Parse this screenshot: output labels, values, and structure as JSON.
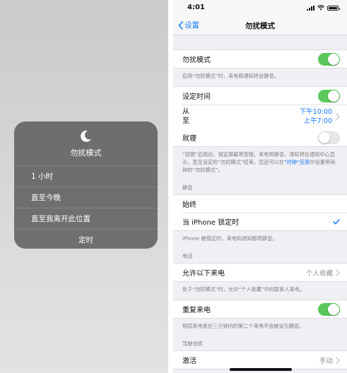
{
  "control_center": {
    "icon": "moon-icon",
    "title": "勿扰模式",
    "options": [
      "1 小时",
      "直至今晚",
      "直至我离开此位置"
    ],
    "footer": "定时"
  },
  "settings": {
    "status": {
      "time": "4:01"
    },
    "nav": {
      "back_label": "设置",
      "title": "勿扰模式"
    },
    "dnd": {
      "label": "勿扰模式",
      "on": true
    },
    "dnd_note": "启用“勿扰模式”时，来电和通知将会静音。",
    "scheduled": {
      "label": "设定时间",
      "on": true
    },
    "from_label": "从",
    "to_label": "至",
    "from_value": "下午10:00",
    "to_value": "上午7:00",
    "bedtime": {
      "label": "就寝",
      "on": false
    },
    "bedtime_note_a": "“就寝”启用后，锁定屏幕将变暗，来电将静音，通知将在通知中心显示，直至设定的“勿扰模式”结束。您还可以在",
    "bedtime_note_link": "“时钟”应用",
    "bedtime_note_b": "中设置带闹钟的“勿扰模式”。",
    "silence_header": "静音",
    "always_label": "始终",
    "while_locked_label": "当 iPhone 锁定时",
    "silence_note": "iPhone 被锁定时，来电和通知都将静音。",
    "phone_header": "电话",
    "allow_calls_label": "允许以下来电",
    "allow_calls_value": "个人收藏",
    "allow_calls_note": "处于“勿扰模式”时，允许“个人收藏”中的联系人来电。",
    "repeated_calls": {
      "label": "重复来电",
      "on": true
    },
    "repeated_calls_note": "相同来电者在三分钟内的第二个来电不会被设为静音。",
    "driving_header": "驾驶勿扰",
    "activate_label": "激活",
    "activate_value": "手动",
    "colors": {
      "accent": "#1479fb",
      "toggle_on": "#5bc85c"
    }
  }
}
